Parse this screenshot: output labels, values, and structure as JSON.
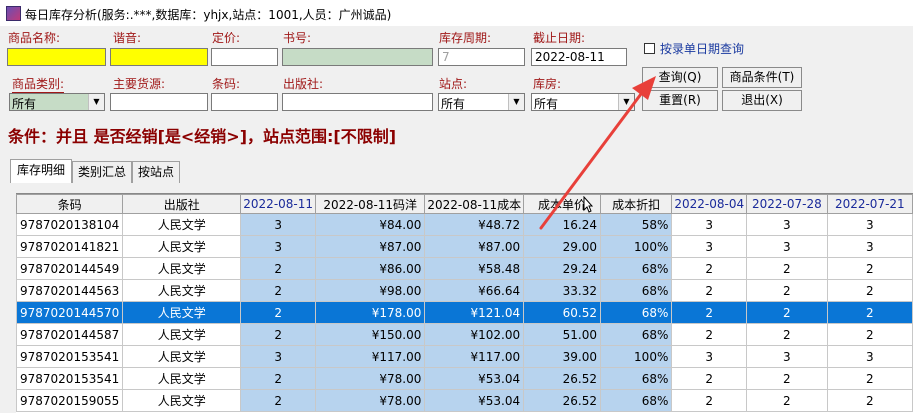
{
  "window": {
    "title": "每日库存分析(服务:.***,数据库：yhjx,站点：1001,人员：广州诚品)"
  },
  "form": {
    "product_name": {
      "label": "商品名称:",
      "value": ""
    },
    "pinyin": {
      "label": "谐音:",
      "value": ""
    },
    "price": {
      "label": "定价:",
      "value": ""
    },
    "book_no": {
      "label": "书号:",
      "value": ""
    },
    "stock_period": {
      "label": "库存周期:",
      "value": "7"
    },
    "end_date": {
      "label": "截止日期:",
      "value": "2022-08-11"
    },
    "single_date": {
      "label": "按录单日期查询",
      "checked": false
    },
    "category": {
      "label": "商品类别:",
      "value": "所有"
    },
    "supplier": {
      "label": "主要货源:",
      "value": ""
    },
    "barcode": {
      "label": "条码:",
      "value": ""
    },
    "publisher": {
      "label": "出版社:",
      "value": ""
    },
    "site": {
      "label": "站点:",
      "value": "所有"
    },
    "warehouse": {
      "label": "库房:",
      "value": "所有"
    }
  },
  "buttons": {
    "query": "查询(Q)",
    "product_conditions": "商品条件(T)",
    "reset": "重置(R)",
    "exit": "退出(X)"
  },
  "condition_text": "条件：并且  是否经销[是<经销>]，站点范围:[不限制]",
  "tabs": [
    "库存明细",
    "类别汇总",
    "按站点"
  ],
  "table": {
    "headers": [
      "条码",
      "出版社",
      "2022-08-11",
      "2022-08-11码洋",
      "2022-08-11成本",
      "成本单价",
      "成本折扣",
      "2022-08-04",
      "2022-07-28",
      "2022-07-21"
    ],
    "rows": [
      [
        "9787020138104",
        "人民文学",
        "3",
        "¥84.00",
        "¥48.72",
        "16.24",
        "58%",
        "3",
        "3",
        "3"
      ],
      [
        "9787020141821",
        "人民文学",
        "3",
        "¥87.00",
        "¥87.00",
        "29.00",
        "100%",
        "3",
        "3",
        "3"
      ],
      [
        "9787020144549",
        "人民文学",
        "2",
        "¥86.00",
        "¥58.48",
        "29.24",
        "68%",
        "2",
        "2",
        "2"
      ],
      [
        "9787020144563",
        "人民文学",
        "2",
        "¥98.00",
        "¥66.64",
        "33.32",
        "68%",
        "2",
        "2",
        "2"
      ],
      [
        "9787020144570",
        "人民文学",
        "2",
        "¥178.00",
        "¥121.04",
        "60.52",
        "68%",
        "2",
        "2",
        "2"
      ],
      [
        "9787020144587",
        "人民文学",
        "2",
        "¥150.00",
        "¥102.00",
        "51.00",
        "68%",
        "2",
        "2",
        "2"
      ],
      [
        "9787020153541",
        "人民文学",
        "3",
        "¥117.00",
        "¥117.00",
        "39.00",
        "100%",
        "3",
        "3",
        "3"
      ],
      [
        "9787020153541",
        "人民文学",
        "2",
        "¥78.00",
        "¥53.04",
        "26.52",
        "68%",
        "2",
        "2",
        "2"
      ],
      [
        "9787020159055",
        "人民文学",
        "2",
        "¥78.00",
        "¥53.04",
        "26.52",
        "68%",
        "2",
        "2",
        "2"
      ]
    ],
    "selected_row": 4
  },
  "colors": {
    "annotation_arrow": "#e8403a",
    "selected_row": "#0a76d6",
    "highlight_column": "#b7d3ee",
    "label": "#a01818",
    "condition": "#8b0000"
  }
}
